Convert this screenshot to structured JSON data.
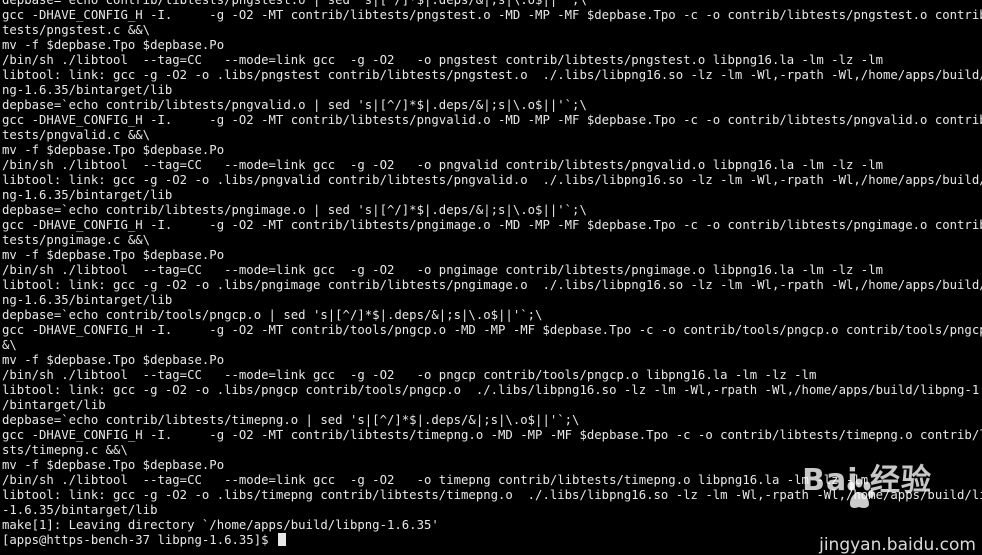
{
  "terminal": {
    "lines": [
      "depbase=`echo contrib/libtests/pngstest.o | sed 's|[^/]*$|.deps/&|;s|\\.o$||'`;\\",
      "gcc -DHAVE_CONFIG_H -I.     -g -O2 -MT contrib/libtests/pngstest.o -MD -MP -MF $depbase.Tpo -c -o contrib/libtests/pngstest.o contrib/lib",
      "tests/pngstest.c &&\\",
      "mv -f $depbase.Tpo $depbase.Po",
      "/bin/sh ./libtool  --tag=CC   --mode=link gcc  -g -O2   -o pngstest contrib/libtests/pngstest.o libpng16.la -lm -lz -lm",
      "libtool: link: gcc -g -O2 -o .libs/pngstest contrib/libtests/pngstest.o  ./.libs/libpng16.so -lz -lm -Wl,-rpath -Wl,/home/apps/build/lib",
      "ng-1.6.35/bintarget/lib",
      "depbase=`echo contrib/libtests/pngvalid.o | sed 's|[^/]*$|.deps/&|;s|\\.o$||'`;\\",
      "gcc -DHAVE_CONFIG_H -I.     -g -O2 -MT contrib/libtests/pngvalid.o -MD -MP -MF $depbase.Tpo -c -o contrib/libtests/pngvalid.o contrib/lib",
      "tests/pngvalid.c &&\\",
      "mv -f $depbase.Tpo $depbase.Po",
      "/bin/sh ./libtool  --tag=CC   --mode=link gcc  -g -O2   -o pngvalid contrib/libtests/pngvalid.o libpng16.la -lm -lz -lm",
      "libtool: link: gcc -g -O2 -o .libs/pngvalid contrib/libtests/pngvalid.o  ./.libs/libpng16.so -lz -lm -Wl,-rpath -Wl,/home/apps/build/lib",
      "ng-1.6.35/bintarget/lib",
      "depbase=`echo contrib/libtests/pngimage.o | sed 's|[^/]*$|.deps/&|;s|\\.o$||'`;\\",
      "gcc -DHAVE_CONFIG_H -I.     -g -O2 -MT contrib/libtests/pngimage.o -MD -MP -MF $depbase.Tpo -c -o contrib/libtests/pngimage.o contrib/lib",
      "tests/pngimage.c &&\\",
      "mv -f $depbase.Tpo $depbase.Po",
      "/bin/sh ./libtool  --tag=CC   --mode=link gcc  -g -O2   -o pngimage contrib/libtests/pngimage.o libpng16.la -lm -lz -lm",
      "libtool: link: gcc -g -O2 -o .libs/pngimage contrib/libtests/pngimage.o  ./.libs/libpng16.so -lz -lm -Wl,-rpath -Wl,/home/apps/build/lib",
      "ng-1.6.35/bintarget/lib",
      "depbase=`echo contrib/tools/pngcp.o | sed 's|[^/]*$|.deps/&|;s|\\.o$||'`;\\",
      "gcc -DHAVE_CONFIG_H -I.     -g -O2 -MT contrib/tools/pngcp.o -MD -MP -MF $depbase.Tpo -c -o contrib/tools/pngcp.o contrib/tools/pngcp.c &",
      "&\\",
      "mv -f $depbase.Tpo $depbase.Po",
      "/bin/sh ./libtool  --tag=CC   --mode=link gcc  -g -O2   -o pngcp contrib/tools/pngcp.o libpng16.la -lm -lz -lm",
      "libtool: link: gcc -g -O2 -o .libs/pngcp contrib/tools/pngcp.o  ./.libs/libpng16.so -lz -lm -Wl,-rpath -Wl,/home/apps/build/libpng-1.6.35",
      "/bintarget/lib",
      "depbase=`echo contrib/libtests/timepng.o | sed 's|[^/]*$|.deps/&|;s|\\.o$||'`;\\",
      "gcc -DHAVE_CONFIG_H -I.     -g -O2 -MT contrib/libtests/timepng.o -MD -MP -MF $depbase.Tpo -c -o contrib/libtests/timepng.o contrib/libte",
      "sts/timepng.c &&\\",
      "mv -f $depbase.Tpo $depbase.Po",
      "/bin/sh ./libtool  --tag=CC   --mode=link gcc  -g -O2   -o timepng contrib/libtests/timepng.o libpng16.la -lm -lz -lm",
      "libtool: link: gcc -g -O2 -o .libs/timepng contrib/libtests/timepng.o  ./.libs/libpng16.so -lz -lm -Wl,-rpath -Wl,/home/apps/build/libpng",
      "-1.6.35/bintarget/lib",
      "make[1]: Leaving directory `/home/apps/build/libpng-1.6.35'"
    ],
    "prompt": "[apps@https-bench-37 libpng-1.6.35]$ ",
    "watermark": {
      "logo_text": "Bai  经验",
      "url": "jingyan.baidu.com"
    }
  }
}
